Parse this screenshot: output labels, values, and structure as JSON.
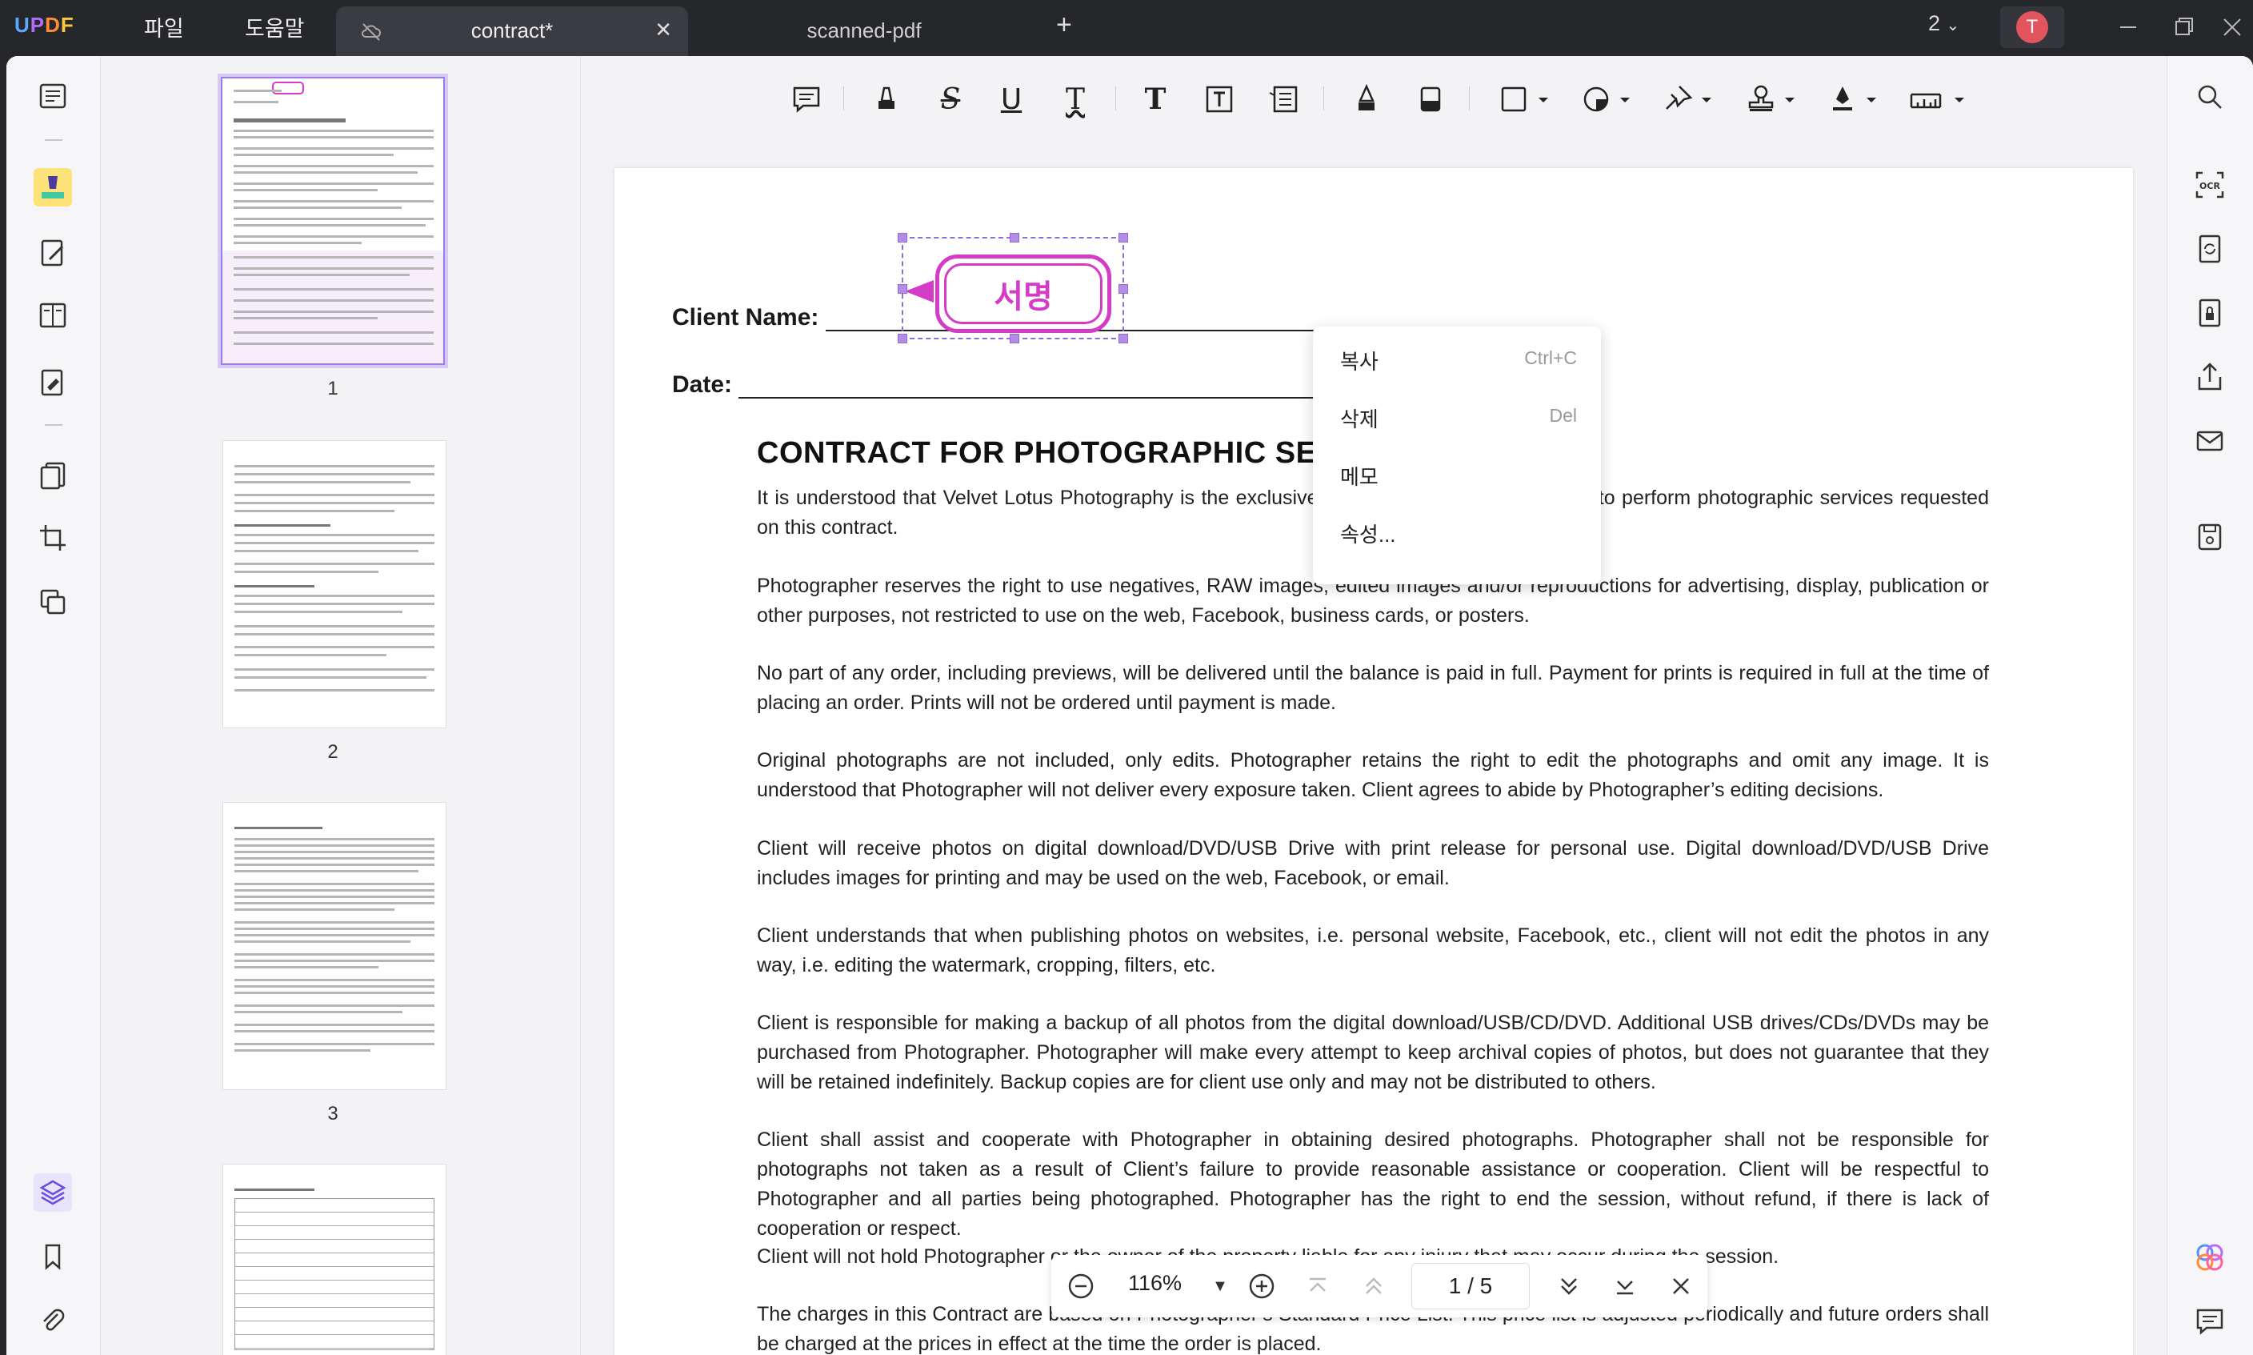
{
  "app": {
    "logo": "UPDF",
    "menu": [
      "파일",
      "도움말"
    ]
  },
  "tabs": [
    {
      "title": "contract*",
      "active": true
    },
    {
      "title": "scanned-pdf",
      "active": false
    }
  ],
  "titlebar": {
    "page_count": "2",
    "avatar_letter": "T"
  },
  "thumbnails": [
    {
      "number": "1"
    },
    {
      "number": "2"
    },
    {
      "number": "3"
    }
  ],
  "stamp": {
    "text": "서명",
    "color": "#d43bc7"
  },
  "document": {
    "client_name_label": "Client Name:",
    "date_label": "Date:",
    "heading": "CONTRACT FOR PHOTOGRAPHIC SERVICES",
    "paragraphs": [
      "It is understood that Velvet Lotus Photography is the exclusive, official photographer retained to perform photographic services requested on this contract.",
      "Photographer reserves the right to use negatives, RAW images, edited images and/or reproductions for advertising, display, publication or other purposes, not restricted to use on the web, Facebook, business cards, or posters.",
      "No part of any order, including previews, will be delivered until the balance is paid in full. Payment for prints is required in full at the time of placing an order. Prints will not be ordered until payment is made.",
      "Original photographs are not included, only edits. Photographer retains the right to edit the photographs and omit any image. It is understood that Photographer will not deliver every exposure taken. Client agrees to abide by Photographer’s editing decisions.",
      "Client will receive photos on digital download/DVD/USB Drive with print release for personal use. Digital download/DVD/USB Drive includes images for printing and may be used on the web, Facebook, or email.",
      "Client understands that when publishing photos on websites, i.e. personal website, Facebook, etc., client will not edit the photos in any way, i.e. editing the watermark, cropping, filters, etc.",
      "Client is responsible for making a backup of all photos from the digital download/USB/CD/DVD. Additional USB drives/CDs/DVDs may be purchased from Photographer. Photographer will make every attempt to keep archival copies of photos, but does not guarantee that they will be retained indefinitely. Backup copies are for client use only and may not be distributed to others.",
      "Client shall assist and cooperate with Photographer in obtaining desired photographs. Photographer shall not be responsible for photographs not taken as a result of Client’s failure to provide reasonable assistance or cooperation. Client will be respectful to Photographer and all parties being photographed. Photographer has the right to end the session, without refund, if there is lack of cooperation or respect.",
      "Client will not hold Photographer or the owner of the property liable for any injury that may occur during the session.",
      "The charges in this Contract are based on Photographer’s Standard Price List. This price list is adjusted periodically and future orders shall be charged at the prices in effect at the time the order is placed."
    ]
  },
  "context_menu": [
    {
      "label": "복사",
      "shortcut": "Ctrl+C"
    },
    {
      "label": "삭제",
      "shortcut": "Del"
    },
    {
      "label": "메모",
      "shortcut": ""
    },
    {
      "label": "속성...",
      "shortcut": ""
    }
  ],
  "bottom_nav": {
    "zoom": "116%",
    "page_indicator": "1 / 5"
  }
}
